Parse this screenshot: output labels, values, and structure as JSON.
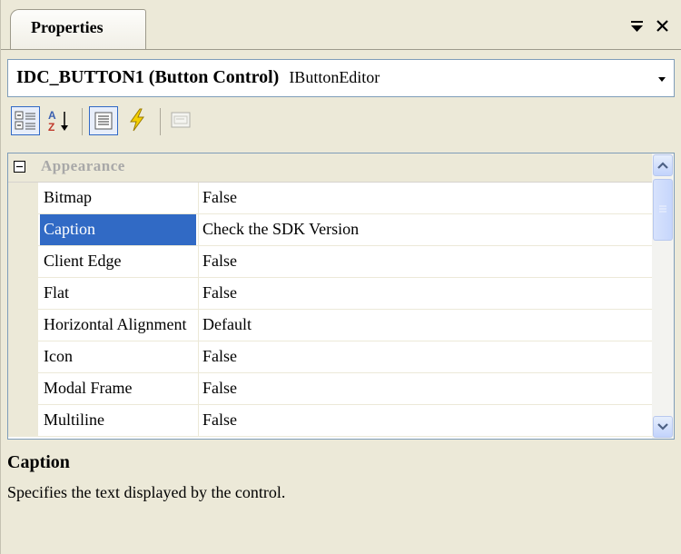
{
  "window": {
    "tab_title": "Properties",
    "pin_icon": "pin-dropdown-icon",
    "close_icon": "close-icon"
  },
  "selector": {
    "object_name": "IDC_BUTTON1",
    "object_type": "(Button Control)",
    "editor": "IButtonEditor"
  },
  "toolbar": {
    "buttons": [
      "categorized-icon",
      "alphabetical-icon",
      "properties-icon",
      "events-icon",
      "property-pages-icon"
    ],
    "active": [
      "categorized-icon",
      "properties-icon"
    ]
  },
  "grid": {
    "category": {
      "label": "Appearance",
      "expanded": true
    },
    "rows": [
      {
        "name": "Bitmap",
        "value": "False"
      },
      {
        "name": "Caption",
        "value": "Check the SDK Version",
        "selected": true
      },
      {
        "name": "Client Edge",
        "value": "False"
      },
      {
        "name": "Flat",
        "value": "False"
      },
      {
        "name": "Horizontal Alignment",
        "value": "Default"
      },
      {
        "name": "Icon",
        "value": "False"
      },
      {
        "name": "Modal Frame",
        "value": "False"
      },
      {
        "name": "Multiline",
        "value": "False"
      }
    ]
  },
  "description": {
    "title": "Caption",
    "text": "Specifies the text displayed by the control."
  },
  "colors": {
    "selection": "#316ac5",
    "panel_background": "#ece9d8",
    "border": "#7f9db9"
  }
}
